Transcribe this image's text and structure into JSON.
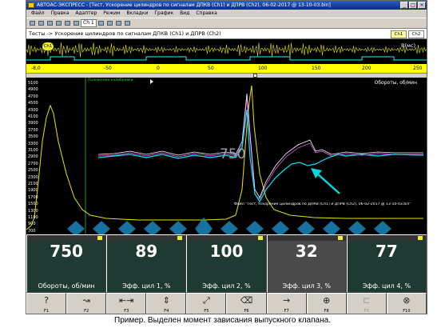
{
  "window": {
    "title": "АВТОАС-ЭКСПРЕСС - [Тест, Ускорение цилиндров по сигналам ДПКВ (Ch1) и ДПРВ (Ch2), 06-02-2017 @ 13-10-03.bin]",
    "buttons": {
      "minimize": "_",
      "maximize": "□",
      "close": "×"
    }
  },
  "menu": [
    "Файл",
    "Правка",
    "Адаптер",
    "Режим",
    "Вкладки",
    "График",
    "Вид",
    "Справка"
  ],
  "toolbar": {
    "channel_select": "Ch 1"
  },
  "test": {
    "caption": "Тесты -> Ускорение цилиндров по сигналам ДПКВ (Ch1) и ДПРВ (Ch2)",
    "tab_ch1": "Ch1",
    "tab_ch2": "Ch2"
  },
  "overview": {
    "badge": "Ch1",
    "axis_unit": "В(мс)",
    "ticks": [
      "-8,0",
      "-50",
      "0",
      "50",
      "100",
      "150",
      "200",
      "250"
    ]
  },
  "plot": {
    "title": "Обороты, об/мин",
    "calibration_label": "Положение калибровки",
    "overlay_value": "750",
    "y_ticks": [
      "5100",
      "4900",
      "4700",
      "4500",
      "4300",
      "4100",
      "3900",
      "3700",
      "3500",
      "3300",
      "3100",
      "2900",
      "2700",
      "2500",
      "2300",
      "2100",
      "1900",
      "1700",
      "1500",
      "1300",
      "1100",
      "900",
      "700",
      "500"
    ],
    "file_caption": "Файл \"Тест, Ускорение цилиндров по ДПКВ (Ch1) и ДПРВ (Ch2), 06-02-2017 @ 13-10-03.bin\""
  },
  "gauges": [
    {
      "value": "750",
      "label": "Обороты, об/мин"
    },
    {
      "value": "89",
      "label": "Эфф. цил 1, %"
    },
    {
      "value": "100",
      "label": "Эфф. цил 2, %"
    },
    {
      "value": "32",
      "label": "Эфф. цил 3, %"
    },
    {
      "value": "77",
      "label": "Эфф. цил 4, %"
    }
  ],
  "fkeys": [
    {
      "name": "F1",
      "glyph": "?"
    },
    {
      "name": "F2",
      "glyph": "↝"
    },
    {
      "name": "F3",
      "glyph": "⇤⇥"
    },
    {
      "name": "F4",
      "glyph": "⇕"
    },
    {
      "name": "F5",
      "glyph": "⤢"
    },
    {
      "name": "F6",
      "glyph": "⌫"
    },
    {
      "name": "F7",
      "glyph": "→"
    },
    {
      "name": "F8",
      "glyph": "⊕"
    },
    {
      "name": "F9",
      "glyph": "⊏"
    },
    {
      "name": "F10",
      "glyph": "⊗"
    }
  ],
  "caption": "Пример. Выделен момент зависания выпускного клапана.",
  "colors": {
    "plot_bg": "#000000",
    "rpm_trace": "#e6e600",
    "cyl_trace": "#00e5ff",
    "gauge_bg": "#1f3a32",
    "accent_arrow": "#00d5e0"
  }
}
